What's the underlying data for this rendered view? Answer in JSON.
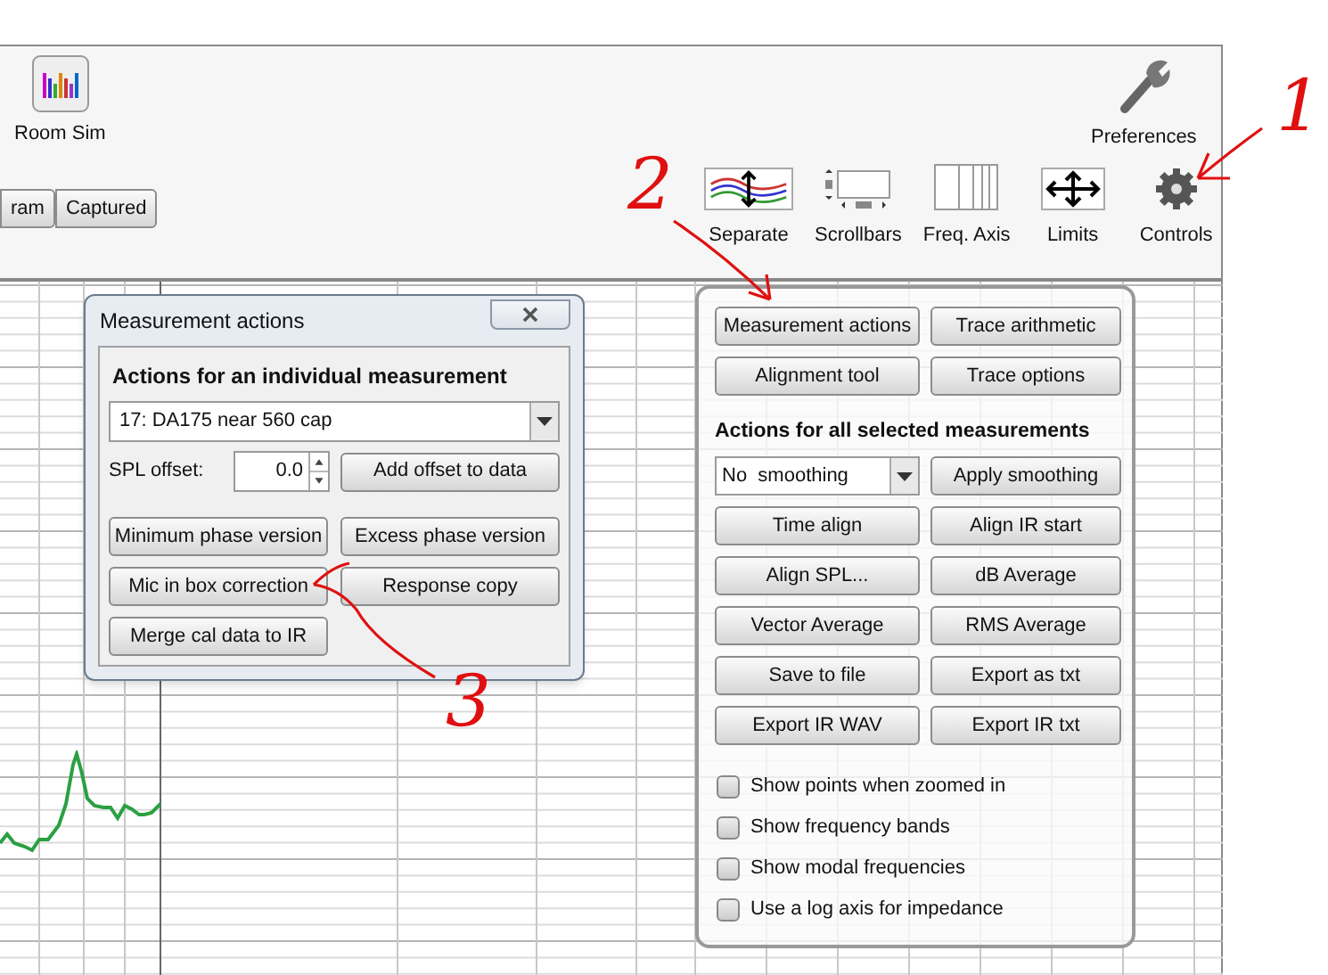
{
  "top_tools": [
    {
      "label": "Room Sim"
    },
    {
      "label": "Preferences"
    }
  ],
  "view_tabs": [
    {
      "label": "ram"
    },
    {
      "label": "Captured"
    }
  ],
  "graph_tools": [
    {
      "label": "Separate"
    },
    {
      "label": "Scrollbars"
    },
    {
      "label": "Freq. Axis"
    },
    {
      "label": "Limits"
    },
    {
      "label": "Controls"
    }
  ],
  "dialog": {
    "title": "Measurement actions",
    "section_title": "Actions for an individual measurement",
    "measurement": "17: DA175 near 560 cap",
    "offset_label": "SPL offset:",
    "offset_value": "0.0",
    "offset_button": "Add offset to data",
    "buttons": [
      "Minimum phase version",
      "Excess phase version",
      "Mic in box correction",
      "Response copy",
      "Merge cal data to IR"
    ]
  },
  "controls_panel": {
    "top_buttons": [
      "Measurement actions",
      "Trace arithmetic",
      "Alignment tool",
      "Trace options"
    ],
    "section_title": "Actions for all selected measurements",
    "smoothing": "No  smoothing",
    "buttons": [
      "Apply smoothing",
      "Time align",
      "Align IR start",
      "Align SPL...",
      "dB Average",
      "Vector Average",
      "RMS Average",
      "Save to file",
      "Export as txt",
      "Export IR WAV",
      "Export IR txt"
    ],
    "options": [
      {
        "label": "Show points when zoomed in",
        "checked": false
      },
      {
        "label": "Show frequency bands",
        "checked": false
      },
      {
        "label": "Show modal frequencies",
        "checked": false
      },
      {
        "label": "Use a log axis for impedance",
        "checked": false
      }
    ]
  },
  "annotations": [
    {
      "text": "1"
    },
    {
      "text": "2"
    },
    {
      "text": "3"
    }
  ]
}
